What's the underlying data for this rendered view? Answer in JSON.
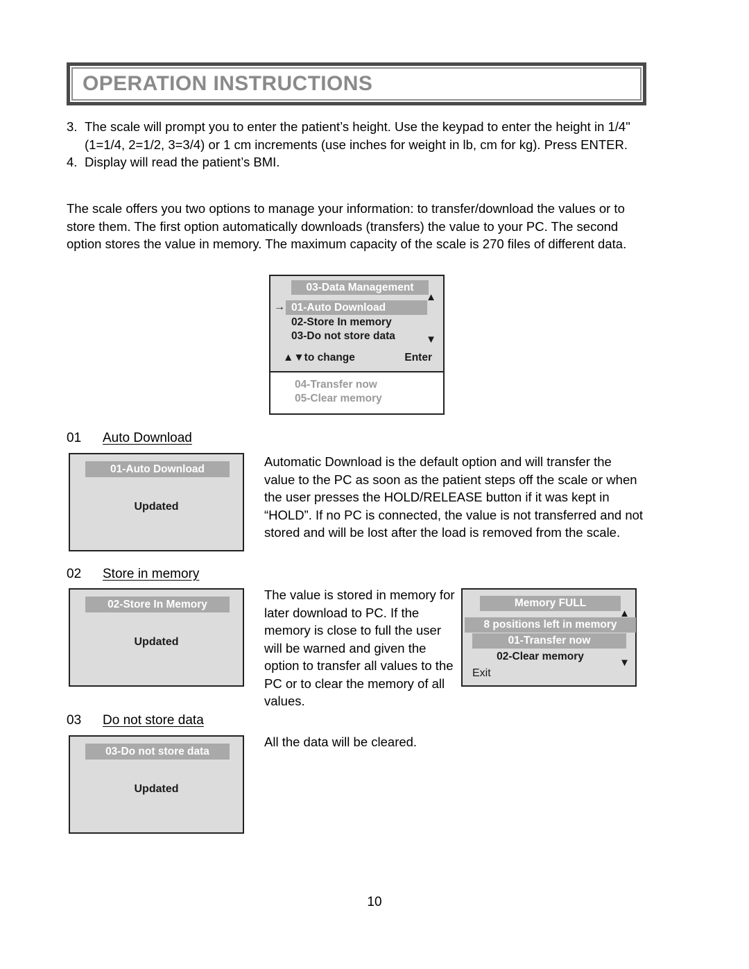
{
  "header": {
    "title": "OPERATION INSTRUCTIONS"
  },
  "numbered_list": [
    {
      "marker": "3.",
      "text": "The scale will prompt you to enter the patient’s height. Use the keypad to enter the height in 1/4\" (1=1/4, 2=1/2, 3=3/4) or 1 cm increments (use inches for weight in lb, cm for kg). Press ENTER."
    },
    {
      "marker": "4.",
      "text": "Display will read the patient’s BMI."
    }
  ],
  "intro_paragraph": "The scale offers you two options to manage your information: to transfer/download the values or to store them. The first option automatically downloads (transfers) the value to your PC. The second option stores the value in memory. The maximum capacity of the scale is 270 files of different data.",
  "data_management_display": {
    "title": "03-Data Management",
    "pointer": "→",
    "scroll_up_icon": "▲",
    "scroll_down_icon": "▼",
    "selected_option": "01-Auto Download",
    "option_2": "02-Store In memory",
    "option_3": "03-Do not store data",
    "footer_hint": "▲▼to change",
    "footer_enter": "Enter",
    "offscreen_option_4": "04-Transfer now",
    "offscreen_option_5": "05-Clear memory"
  },
  "sections": [
    {
      "number": "01",
      "label": "Auto Download",
      "display": {
        "bar": "01-Auto Download",
        "status": "Updated"
      },
      "paragraph": "Automatic Download is the default option and will transfer the value to the PC as soon as the patient steps off the scale or when the user presses the HOLD/RELEASE button if it was kept in “HOLD”. If no PC is connected, the value is not transferred and not stored and will be lost after the load is removed from the scale."
    },
    {
      "number": "02",
      "label": "Store in memory",
      "display": {
        "bar": "02-Store In Memory",
        "status": "Updated"
      },
      "paragraph": "The value is stored in memory for later download to PC. If the memory is close to full the user will be warned and given the option to transfer all values to the PC or to clear the memory of all values."
    },
    {
      "number": "03",
      "label": "Do not store data",
      "display": {
        "bar": "03-Do not store data",
        "status": "Updated"
      },
      "paragraph": "All the data will be cleared."
    }
  ],
  "memory_full_display": {
    "title": "Memory FULL",
    "scroll_up_icon": "▲",
    "scroll_down_icon": "▼",
    "positions_left": "8 positions left in memory",
    "option_1": "01-Transfer now",
    "option_2": "02-Clear memory",
    "exit_label": "Exit"
  },
  "page_number": "10",
  "colors": {
    "banner_border": "#4a4a4a",
    "banner_title_text": "#8a8a8a",
    "lcd_background": "#dcdcdc",
    "lcd_highlight_bar": "#a9a9a9",
    "lcd_dim_text": "#9a9a9a"
  }
}
